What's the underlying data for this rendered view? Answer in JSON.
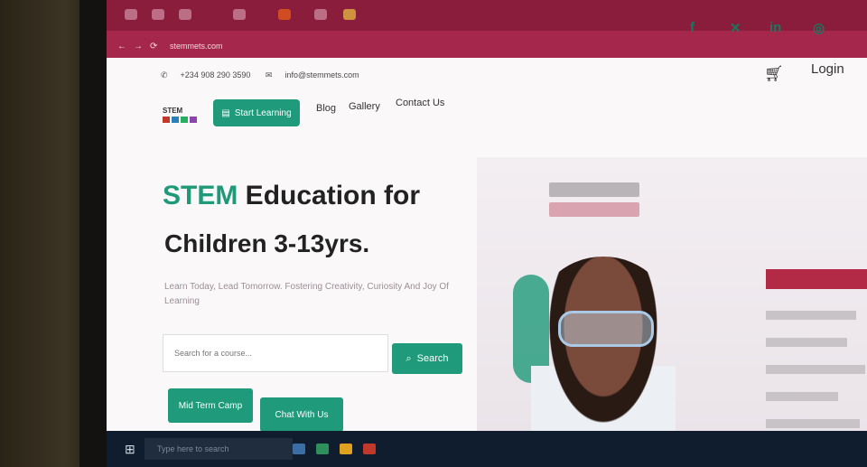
{
  "browser": {
    "url": "stemmets.com"
  },
  "topbar": {
    "phone": "+234 908 290 3590",
    "email": "info@stemmets.com"
  },
  "social": {
    "icons": [
      "facebook-icon",
      "x-icon",
      "linkedin-icon",
      "instagram-icon"
    ]
  },
  "header": {
    "login": "Login",
    "logo_text": "STEM"
  },
  "nav": {
    "start_learning": "Start Learning",
    "blog": "Blog",
    "gallery": "Gallery",
    "contact": "Contact Us"
  },
  "hero": {
    "title_accent": "STEM",
    "title_rest": " Education for",
    "title_line2": "Children 3-13yrs.",
    "subtitle": "Learn Today, Lead Tomorrow. Fostering Creativity, Curiosity And Joy Of Learning"
  },
  "search": {
    "placeholder": "Search for a course...",
    "button": "Search"
  },
  "ctas": {
    "camp": "Mid Term Camp",
    "chat": "Chat With Us"
  },
  "taskbar": {
    "search_placeholder": "Type here to search"
  },
  "colors": {
    "accent": "#1f9a7a",
    "browser_frame": "#8a1d3c"
  }
}
